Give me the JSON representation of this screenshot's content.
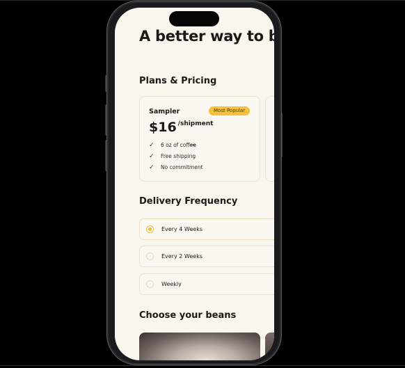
{
  "hero": {
    "title": "A better way to brew"
  },
  "plans": {
    "heading": "Plans & Pricing",
    "card": {
      "name": "Sampler",
      "badge": "Most Popular",
      "price": "$16",
      "unit": "/shipment",
      "features": [
        {
          "pre": "6 oz of cof",
          "struck": "fee"
        },
        {
          "text": "Free shipping"
        },
        {
          "text": "No commitment"
        }
      ]
    }
  },
  "delivery": {
    "heading": "Delivery Frequency",
    "options": [
      {
        "label": "Every 4 Weeks",
        "selected": true
      },
      {
        "label": "Every 2 Weeks",
        "selected": false
      },
      {
        "label": "Weekly",
        "selected": false
      }
    ]
  },
  "beans": {
    "heading": "Choose your beans"
  },
  "colors": {
    "accent": "#f2bb35",
    "background": "#faf6ee",
    "text": "#1b1a17"
  }
}
